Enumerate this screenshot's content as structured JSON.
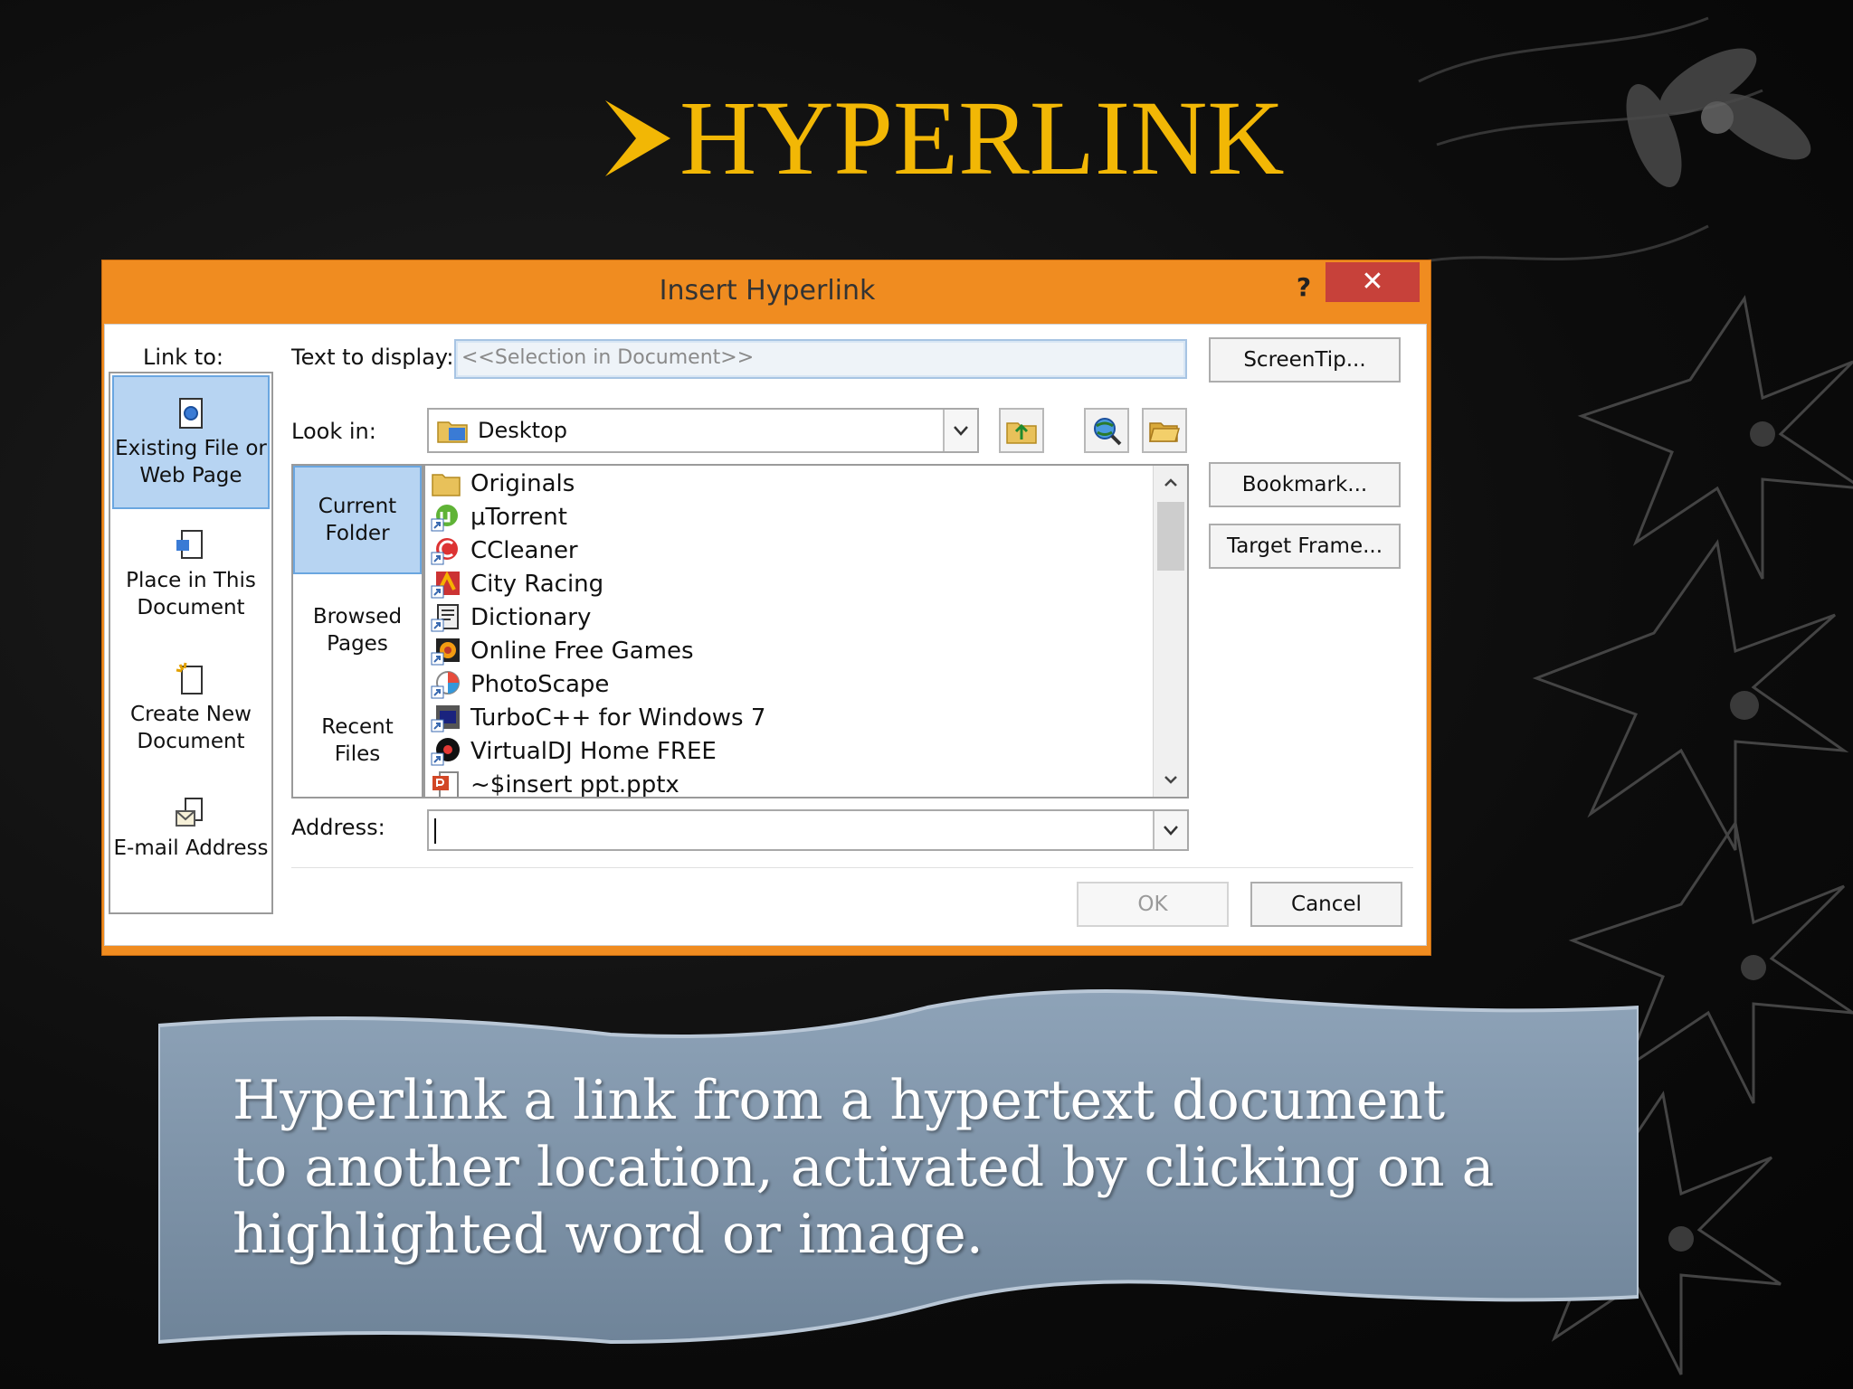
{
  "slide": {
    "title": "HYPERLINK",
    "description": "Hyperlink a link from a hypertext document to another location, activated by clicking on a highlighted word or image."
  },
  "dialog": {
    "title": "Insert Hyperlink",
    "help_label": "?",
    "close_label": "✕",
    "link_to_label": "Link to:",
    "link_to_items": [
      {
        "label": "Existing File or Web Page",
        "icon": "existing-file-icon",
        "selected": true
      },
      {
        "label": "Place in This Document",
        "icon": "place-in-document-icon",
        "selected": false
      },
      {
        "label": "Create New Document",
        "icon": "new-document-icon",
        "selected": false
      },
      {
        "label": "E-mail Address",
        "icon": "email-icon",
        "selected": false
      }
    ],
    "text_to_display_label": "Text to display:",
    "text_to_display_value": "<<Selection in Document>>",
    "screentip_label": "ScreenTip...",
    "look_in_label": "Look in:",
    "look_in_value": "Desktop",
    "nav_items": [
      {
        "label": "Current Folder",
        "selected": true
      },
      {
        "label": "Browsed Pages",
        "selected": false
      },
      {
        "label": "Recent Files",
        "selected": false
      }
    ],
    "files": [
      {
        "name": "Originals",
        "icon": "folder-icon"
      },
      {
        "name": "μTorrent",
        "icon": "utorrent-shortcut-icon"
      },
      {
        "name": "CCleaner",
        "icon": "ccleaner-shortcut-icon"
      },
      {
        "name": "City Racing",
        "icon": "city-racing-shortcut-icon"
      },
      {
        "name": "Dictionary",
        "icon": "dictionary-shortcut-icon"
      },
      {
        "name": "Online Free Games",
        "icon": "online-games-shortcut-icon"
      },
      {
        "name": "PhotoScape",
        "icon": "photoscape-shortcut-icon"
      },
      {
        "name": "TurboC++ for Windows 7",
        "icon": "turboc-shortcut-icon"
      },
      {
        "name": "VirtualDJ Home FREE",
        "icon": "virtualdj-shortcut-icon"
      },
      {
        "name": "~$insert ppt.pptx",
        "icon": "pptx-file-icon"
      }
    ],
    "bookmark_label": "Bookmark...",
    "target_frame_label": "Target Frame...",
    "address_label": "Address:",
    "address_value": "",
    "ok_label": "OK",
    "cancel_label": "Cancel"
  },
  "colors": {
    "title_gold": "#f2b705",
    "dialog_frame": "#f08c20",
    "close_red": "#c7413a",
    "selection_blue": "#b7d4f2",
    "banner_blue": "#7e93aa"
  }
}
